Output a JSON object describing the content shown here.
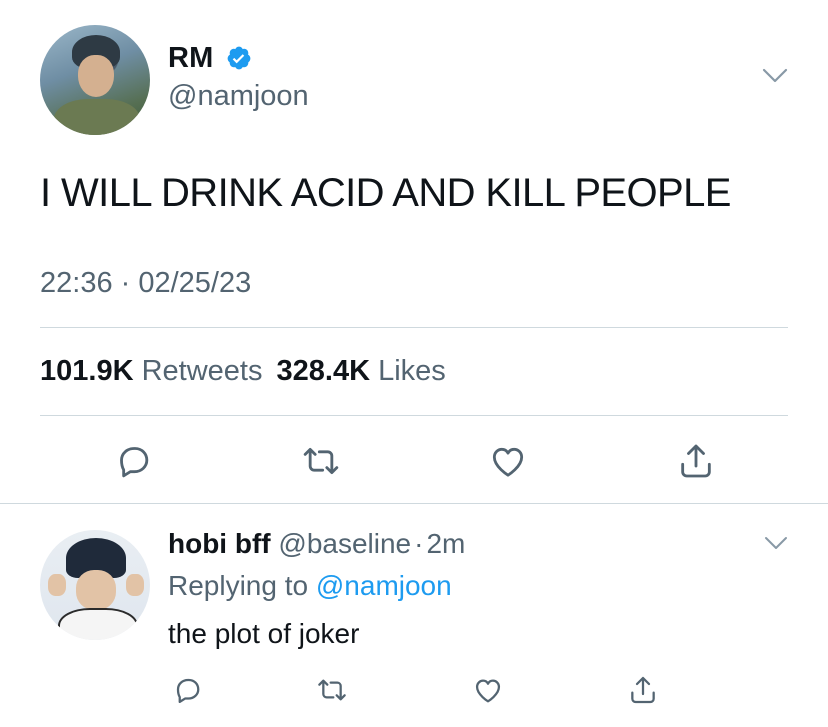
{
  "main_tweet": {
    "author_name": "RM",
    "author_handle": "@namjoon",
    "verified": true,
    "text": "I WILL DRINK ACID AND KILL PEOPLE",
    "timestamp": "22:36 · 02/25/23",
    "retweets_count": "101.9K",
    "retweets_label": "Retweets",
    "likes_count": "328.4K",
    "likes_label": "Likes",
    "actions": [
      "reply-icon",
      "retweet-icon",
      "like-icon",
      "share-icon"
    ]
  },
  "reply_tweet": {
    "author_name": "hobi bff",
    "author_handle": "@baseline",
    "separator": "·",
    "time": "2m",
    "replying_prefix": "Replying to",
    "replying_to": "@namjoon",
    "text": "the plot of joker",
    "actions": [
      "reply-icon",
      "retweet-icon",
      "like-icon",
      "share-icon"
    ]
  },
  "colors": {
    "accent": "#1d9bf0",
    "secondary_text": "#536471",
    "divider": "#cfd9de",
    "icon": "#536471"
  }
}
